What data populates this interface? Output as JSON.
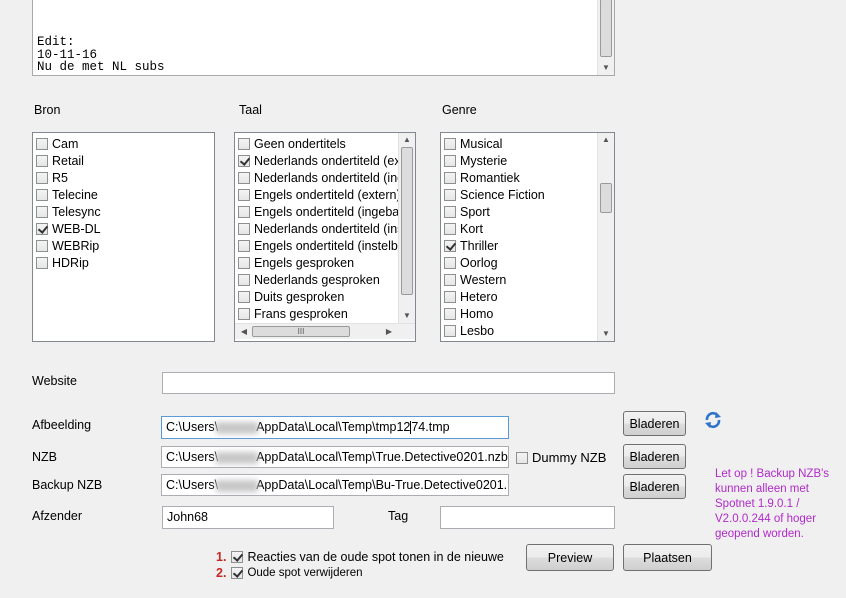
{
  "description": {
    "lines": [
      "Edit:",
      "10-11-16",
      "Nu de met NL subs"
    ]
  },
  "bron": {
    "label": "Bron",
    "items": [
      {
        "label": "Cam",
        "checked": false
      },
      {
        "label": "Retail",
        "checked": false
      },
      {
        "label": "R5",
        "checked": false
      },
      {
        "label": "Telecine",
        "checked": false
      },
      {
        "label": "Telesync",
        "checked": false
      },
      {
        "label": "WEB-DL",
        "checked": true
      },
      {
        "label": "WEBRip",
        "checked": false
      },
      {
        "label": "HDRip",
        "checked": false
      }
    ]
  },
  "taal": {
    "label": "Taal",
    "items": [
      {
        "label": "Geen ondertitels",
        "checked": false
      },
      {
        "label": "Nederlands ondertiteld (ex",
        "checked": true
      },
      {
        "label": "Nederlands ondertiteld (inc",
        "checked": false
      },
      {
        "label": "Engels ondertiteld (extern)",
        "checked": false
      },
      {
        "label": "Engels ondertiteld (ingebak",
        "checked": false
      },
      {
        "label": "Nederlands ondertiteld (ins",
        "checked": false
      },
      {
        "label": "Engels ondertiteld (instelba",
        "checked": false
      },
      {
        "label": "Engels gesproken",
        "checked": false
      },
      {
        "label": "Nederlands gesproken",
        "checked": false
      },
      {
        "label": "Duits gesproken",
        "checked": false
      },
      {
        "label": "Frans gesproken",
        "checked": false
      }
    ],
    "hscroll_grip": "III"
  },
  "genre": {
    "label": "Genre",
    "items": [
      {
        "label": "Musical",
        "checked": false
      },
      {
        "label": "Mysterie",
        "checked": false
      },
      {
        "label": "Romantiek",
        "checked": false
      },
      {
        "label": "Science Fiction",
        "checked": false
      },
      {
        "label": "Sport",
        "checked": false
      },
      {
        "label": "Kort",
        "checked": false
      },
      {
        "label": "Thriller",
        "checked": true
      },
      {
        "label": "Oorlog",
        "checked": false
      },
      {
        "label": "Western",
        "checked": false
      },
      {
        "label": "Hetero",
        "checked": false
      },
      {
        "label": "Homo",
        "checked": false
      },
      {
        "label": "Lesbo",
        "checked": false
      }
    ]
  },
  "website": {
    "label": "Website",
    "value": ""
  },
  "afbeelding": {
    "label": "Afbeelding",
    "value_pre": "C:\\Users\\",
    "value_post": "AppData\\Local\\Temp\\tmp12",
    "value_tail": "74.tmp",
    "browse": "Bladeren"
  },
  "nzb": {
    "label": "NZB",
    "value_pre": "C:\\Users\\",
    "value_post": "AppData\\Local\\Temp\\True.Detective0201.nzb",
    "browse": "Bladeren",
    "dummy_label": "Dummy NZB",
    "dummy_checked": false
  },
  "backup_nzb": {
    "label": "Backup NZB",
    "value_pre": "C:\\Users\\",
    "value_post": "AppData\\Local\\Temp\\Bu-True.Detective0201.n",
    "browse": "Bladeren"
  },
  "afzender": {
    "label": "Afzender",
    "value": "John68"
  },
  "tag": {
    "label": "Tag",
    "value": ""
  },
  "note": {
    "lines": [
      "Let op ! Backup NZB's",
      "kunnen alleen met",
      "Spotnet 1.9.0.1 /",
      "V2.0.0.244 of hoger",
      "geopend worden."
    ]
  },
  "options": {
    "reacties": {
      "num": "1.",
      "label": "Reacties van de oude spot tonen in de nieuwe",
      "checked": true
    },
    "verwijderen": {
      "num": "2.",
      "label": "Oude spot verwijderen",
      "checked": true
    }
  },
  "buttons": {
    "preview": "Preview",
    "plaatsen": "Plaatsen"
  },
  "colors": {
    "note": "#b12aca",
    "num": "#c62828",
    "refresh": "#2f74c8"
  }
}
